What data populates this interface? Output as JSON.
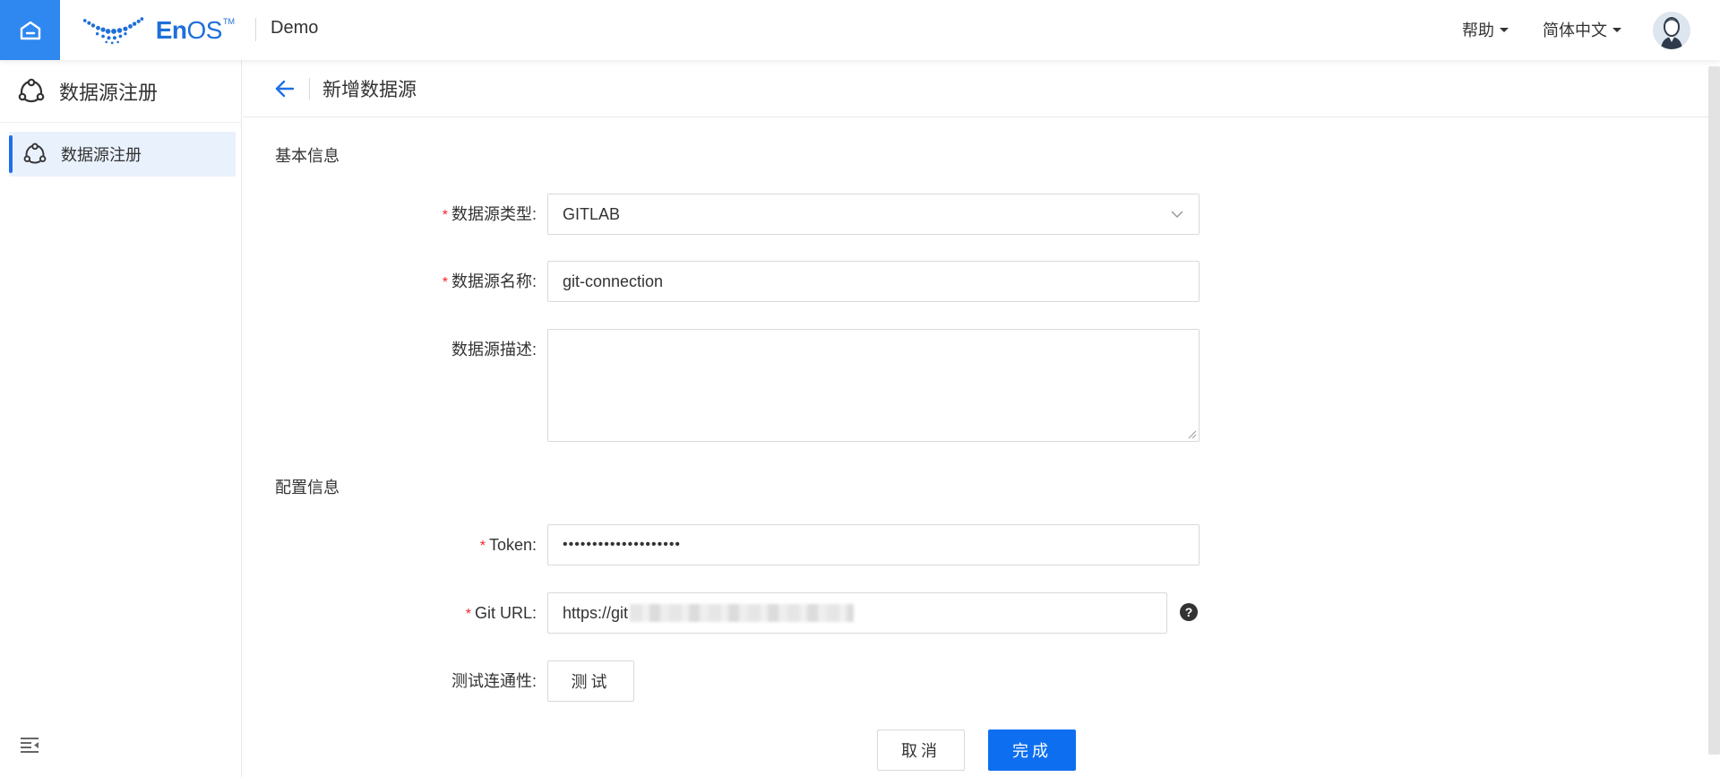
{
  "topbar": {
    "logo_text_en": "En",
    "logo_text_os": "OS",
    "logo_tm": "TM",
    "app_name": "Demo",
    "help_label": "帮助",
    "language_label": "简体中文"
  },
  "sidebar": {
    "header_title": "数据源注册",
    "items": [
      {
        "label": "数据源注册",
        "active": true
      }
    ]
  },
  "page": {
    "title": "新增数据源"
  },
  "form": {
    "basic_section_title": "基本信息",
    "config_section_title": "配置信息",
    "type": {
      "label": "数据源类型:",
      "value": "GITLAB",
      "required": true
    },
    "name": {
      "label": "数据源名称:",
      "value": "git-connection",
      "required": true
    },
    "description": {
      "label": "数据源描述:",
      "value": "",
      "required": false
    },
    "token": {
      "label": "Token:",
      "value": "••••••••••••••••••••",
      "required": true
    },
    "git_url": {
      "label": "Git URL:",
      "value": "https://git",
      "required": true
    },
    "connectivity": {
      "label": "测试连通性:",
      "button_label": "测试"
    },
    "required_mark": "*",
    "help_mark": "?"
  },
  "actions": {
    "cancel_label": "取消",
    "done_label": "完成"
  },
  "colors": {
    "primary": "#0d6ff0",
    "home_bg": "#2f87f0",
    "required": "#f5222d",
    "sidebar_active_bg": "#e9f1fd"
  }
}
